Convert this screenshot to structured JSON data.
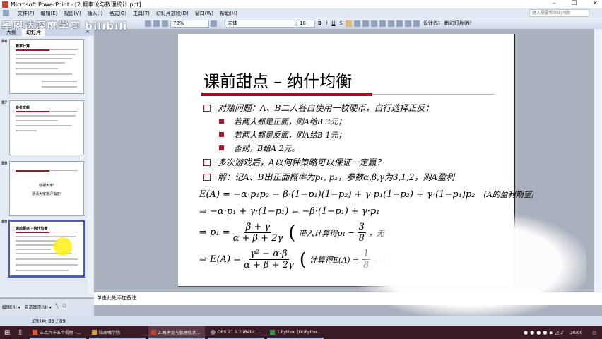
{
  "window": {
    "title": "Microsoft PowerPoint - [2.概率论与数理统计.ppt]",
    "min": "–",
    "max": "☐",
    "close": "✕"
  },
  "menu": [
    "文件(F)",
    "编辑(E)",
    "视图(V)",
    "插入(I)",
    "格式(O)",
    "工具(T)",
    "幻灯片放映(D)",
    "窗口(W)",
    "帮助(H)"
  ],
  "help_placeholder": "键入需要帮助的问题",
  "toolbar": {
    "zoom": "78%",
    "font": "宋体",
    "size": "18",
    "bold": "B",
    "italic": "I",
    "underline": "U",
    "shadow": "S",
    "design": "设计(S)",
    "new_slide": "新幻灯片(N)"
  },
  "watermark": "吴恩达深度学习 bilibili",
  "pane": {
    "tab_outline": "大纲",
    "tab_slides": "幻灯片",
    "close": "×"
  },
  "thumbs": [
    {
      "num": "86",
      "title": "概率计算"
    },
    {
      "num": "87",
      "title": "参考文献"
    },
    {
      "num": "88",
      "title": "",
      "lines": [
        "感谢大家!",
        "恳请大家批评指正!"
      ]
    },
    {
      "num": "89",
      "title": "课前甜点 - 纳什均衡"
    }
  ],
  "slide": {
    "title": "课前甜点 – 纳什均衡",
    "bullets": [
      "对赌问题：A、B二人各自使用一枚硬币，自行选择正反；",
      "若两人都是正面，则A给B 3元；",
      "若两人都是反面，则A给B 1元；",
      "否则，B给A 2元。",
      "多次游戏后，A以何种策略可以保证一定赢？",
      "解：记A、B出正面概率为p₁, p₂，参数α,β,γ为3,1,2，则A盈利"
    ],
    "eq1": "E(A) = −α·p₁p₂ − β·(1−p₁)(1−p₂) + γ·p₁(1−p₂) + γ·(1−p₁)p₂",
    "eq1_note": "(A的盈利期望)",
    "eq2": "⇒ −α·p₁ + γ·(1−p₁) = −β·(1−p₁) + γ·p₁",
    "eq3_lhs": "⇒ p₁ =",
    "eq3_num": "β + γ",
    "eq3_den": "α + β + 2γ",
    "eq3_note": "带入计算得p₁ =",
    "eq3_vnum": "3",
    "eq3_vden": "8",
    "eq3_tail": "，无",
    "eq4_lhs": "⇒ E(A) =",
    "eq4_num": "γ² − α·β",
    "eq4_den": "α + β + 2γ",
    "eq4_note": "计算得E(A) =",
    "eq4_vnum": "1",
    "eq4_vden": "8",
    "eq4_tail": "，A"
  },
  "notes_placeholder": "单击此处添加备注",
  "drawbar": {
    "draw": "绘图(R) ▾",
    "autoshape": "自选图形(U) ▾"
  },
  "status": "幻灯片 89 / 89",
  "taskbar": [
    "三百六十五个视频 -...",
    "陆家嘴学院",
    "2.概率论与数理统计...",
    "OBS 21.1.2 (64bit, ...",
    "1.Python [D:\\Pytho..."
  ],
  "clock": "20:00"
}
